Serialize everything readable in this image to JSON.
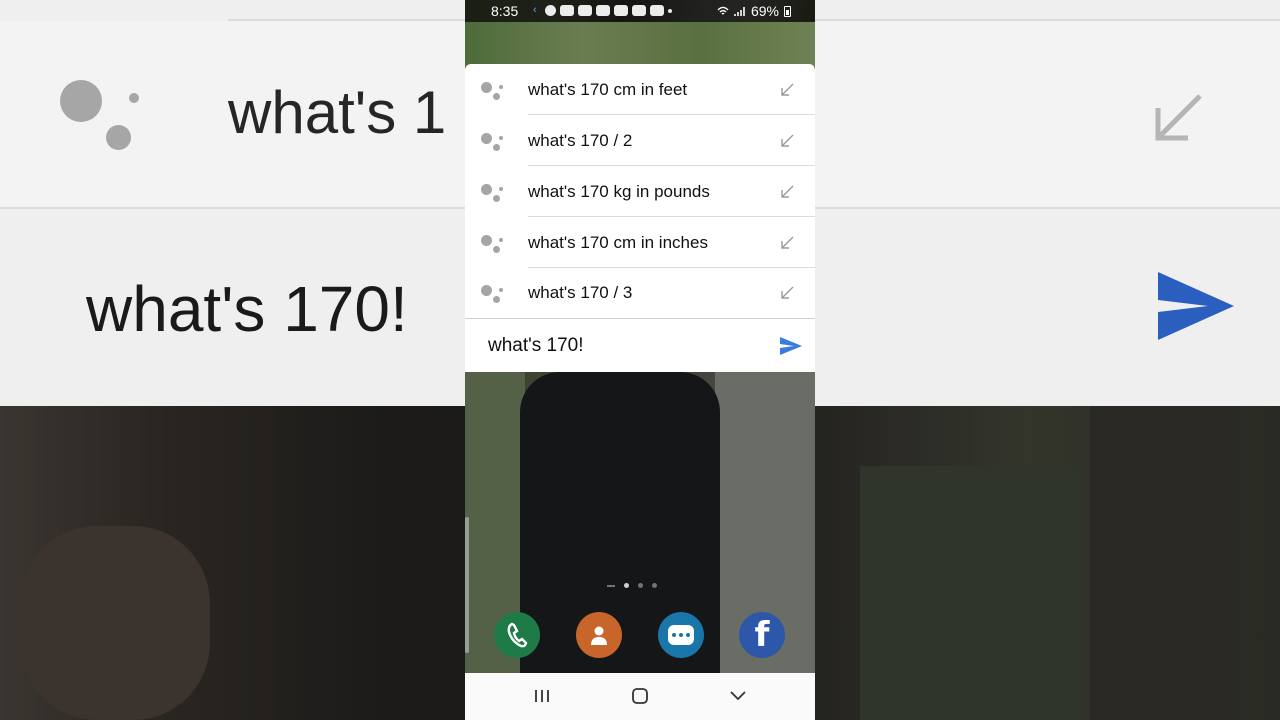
{
  "status_bar": {
    "time": "8:35",
    "battery": "69%"
  },
  "background": {
    "suggestion_fragment": "what's 1",
    "input_fragment": "what's 170!"
  },
  "suggestions": [
    {
      "text": "what's 170 cm in feet"
    },
    {
      "text": "what's 170 / 2"
    },
    {
      "text": "what's 170 kg in pounds"
    },
    {
      "text": "what's 170 cm in inches"
    },
    {
      "text": "what's 170 / 3"
    }
  ],
  "input": {
    "value": "what's 170!"
  },
  "colors": {
    "send_accent": "#3a7be0",
    "assistant_dots": "#a5a5a5"
  },
  "dock": {
    "apps": [
      "phone-icon",
      "contacts-icon",
      "messages-icon",
      "facebook-icon"
    ],
    "facebook_glyph": "f"
  },
  "icons": {
    "suggestion_leading": "google-assistant-icon",
    "suggestion_trailing": "fill-query-arrow-icon",
    "send": "send-icon"
  }
}
